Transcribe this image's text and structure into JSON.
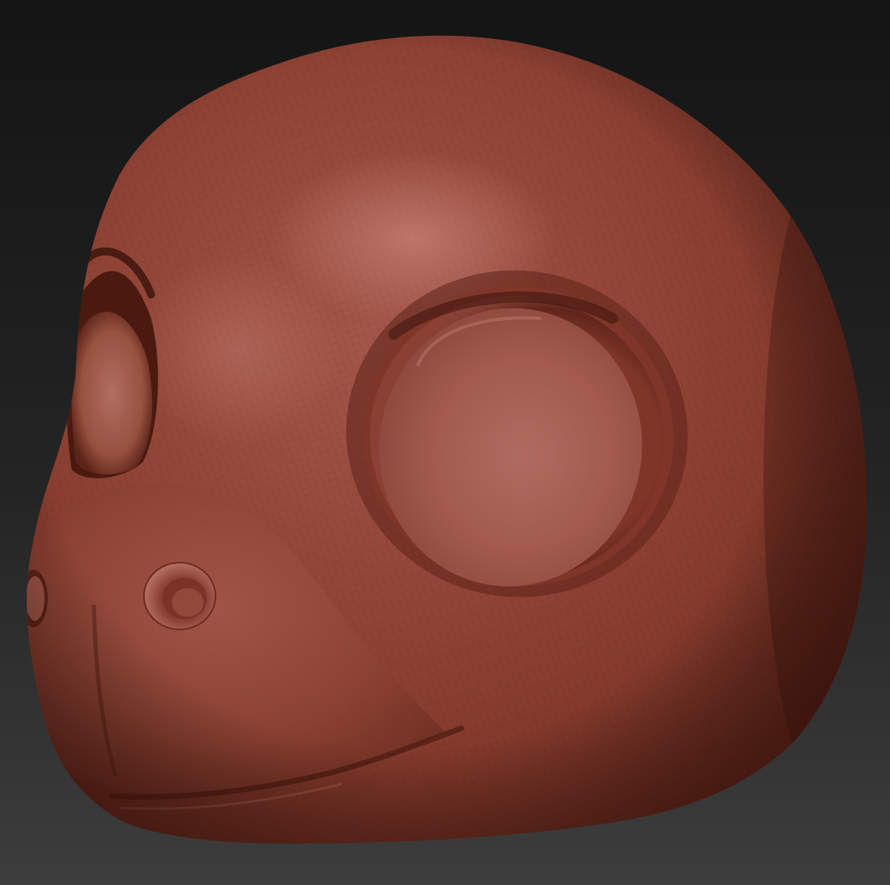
{
  "scene": {
    "subject": "sculpted-head-model",
    "colors": {
      "background_top": "#151515",
      "background_bottom": "#3c3c3c",
      "clay_highlight": "#c0766b",
      "clay_base": "#9c4a3a",
      "clay_mid": "#7e3a2d",
      "clay_shadow": "#4a1f17",
      "wire": "#5a2418"
    }
  }
}
